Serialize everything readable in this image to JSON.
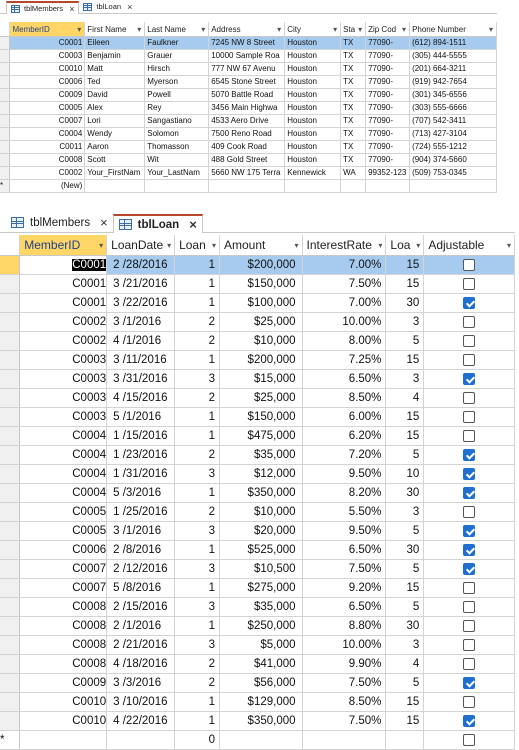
{
  "members": {
    "tabs": [
      {
        "label": "tblMembers",
        "active": true
      },
      {
        "label": "tblLoan",
        "active": false
      }
    ],
    "columns": [
      "MemberID",
      "First Name",
      "Last Name",
      "Address",
      "City",
      "Sta",
      "Zip Cod",
      "Phone Number"
    ],
    "rows": [
      [
        "C0001",
        "Eileen",
        "Faulkner",
        "7245 NW 8 Street",
        "Houston",
        "TX",
        "77090-",
        "(612) 894-1511"
      ],
      [
        "C0003",
        "Benjamin",
        "Grauer",
        "10000 Sample Roa",
        "Houston",
        "TX",
        "77090-",
        "(305) 444-5555"
      ],
      [
        "C0010",
        "Matt",
        "Hirsch",
        "777 NW 67 Avenu",
        "Houston",
        "TX",
        "77090-",
        "(201) 664-3211"
      ],
      [
        "C0006",
        "Ted",
        "Myerson",
        "6545 Stone Street",
        "Houston",
        "TX",
        "77090-",
        "(919) 942-7654"
      ],
      [
        "C0009",
        "David",
        "Powell",
        "5070 Battle Road",
        "Houston",
        "TX",
        "77090-",
        "(301) 345-6556"
      ],
      [
        "C0005",
        "Alex",
        "Rey",
        "3456 Main Highwa",
        "Houston",
        "TX",
        "77090-",
        "(303) 555-6666"
      ],
      [
        "C0007",
        "Lori",
        "Sangastiano",
        "4533 Aero Drive",
        "Houston",
        "TX",
        "77090-",
        "(707) 542-3411"
      ],
      [
        "C0004",
        "Wendy",
        "Solomon",
        "7500 Reno Road",
        "Houston",
        "TX",
        "77090-",
        "(713) 427-3104"
      ],
      [
        "C0011",
        "Aaron",
        "Thomasson",
        "409 Cook Road",
        "Houston",
        "TX",
        "77090-",
        "(724) 555-1212"
      ],
      [
        "C0008",
        "Scott",
        "Wit",
        "488 Gold Street",
        "Houston",
        "TX",
        "77090-",
        "(904) 374-5660"
      ],
      [
        "C0002",
        "Your_FirstNam",
        "Your_LastNam",
        "5660 NW 175 Terra",
        "Kennewick",
        "WA",
        "99352-123",
        "(509) 753-0345"
      ]
    ],
    "new_row": {
      "marker": "*",
      "id_text": "(New)"
    }
  },
  "loan": {
    "tabs": [
      {
        "label": "tblMembers",
        "active": false
      },
      {
        "label": "tblLoan",
        "active": true
      }
    ],
    "columns": [
      "MemberID",
      "LoanDate",
      "Loan",
      "Amount",
      "InterestRate",
      "Loa",
      "Adjustable"
    ],
    "rows": [
      [
        "C0001",
        "2 /28/2016",
        "1",
        "$200,000",
        "7.00%",
        "15",
        false
      ],
      [
        "C0001",
        "3 /21/2016",
        "1",
        "$150,000",
        "7.50%",
        "15",
        false
      ],
      [
        "C0001",
        "3 /22/2016",
        "1",
        "$100,000",
        "7.00%",
        "30",
        true
      ],
      [
        "C0002",
        "3 /1/2016",
        "2",
        "$25,000",
        "10.00%",
        "3",
        false
      ],
      [
        "C0002",
        "4 /1/2016",
        "2",
        "$10,000",
        "8.00%",
        "5",
        false
      ],
      [
        "C0003",
        "3 /11/2016",
        "1",
        "$200,000",
        "7.25%",
        "15",
        false
      ],
      [
        "C0003",
        "3 /31/2016",
        "3",
        "$15,000",
        "6.50%",
        "3",
        true
      ],
      [
        "C0003",
        "4 /15/2016",
        "2",
        "$25,000",
        "8.50%",
        "4",
        false
      ],
      [
        "C0003",
        "5 /1/2016",
        "1",
        "$150,000",
        "6.00%",
        "15",
        false
      ],
      [
        "C0004",
        "1 /15/2016",
        "1",
        "$475,000",
        "6.20%",
        "15",
        false
      ],
      [
        "C0004",
        "1 /23/2016",
        "2",
        "$35,000",
        "7.20%",
        "5",
        true
      ],
      [
        "C0004",
        "1 /31/2016",
        "3",
        "$12,000",
        "9.50%",
        "10",
        true
      ],
      [
        "C0004",
        "5 /3/2016",
        "1",
        "$350,000",
        "8.20%",
        "30",
        true
      ],
      [
        "C0005",
        "1 /25/2016",
        "2",
        "$10,000",
        "5.50%",
        "3",
        false
      ],
      [
        "C0005",
        "3 /1/2016",
        "3",
        "$20,000",
        "9.50%",
        "5",
        true
      ],
      [
        "C0006",
        "2 /8/2016",
        "1",
        "$525,000",
        "6.50%",
        "30",
        true
      ],
      [
        "C0007",
        "2 /12/2016",
        "3",
        "$10,500",
        "7.50%",
        "5",
        true
      ],
      [
        "C0007",
        "5 /8/2016",
        "1",
        "$275,000",
        "9.20%",
        "15",
        false
      ],
      [
        "C0008",
        "2 /15/2016",
        "3",
        "$35,000",
        "6.50%",
        "5",
        false
      ],
      [
        "C0008",
        "2 /1/2016",
        "1",
        "$250,000",
        "8.80%",
        "30",
        false
      ],
      [
        "C0008",
        "2 /21/2016",
        "3",
        "$5,000",
        "10.00%",
        "3",
        false
      ],
      [
        "C0008",
        "4 /18/2016",
        "2",
        "$41,000",
        "9.90%",
        "4",
        false
      ],
      [
        "C0009",
        "3 /3/2016",
        "2",
        "$56,000",
        "7.50%",
        "5",
        true
      ],
      [
        "C0010",
        "3 /10/2016",
        "1",
        "$129,000",
        "8.50%",
        "15",
        false
      ],
      [
        "C0010",
        "4 /22/2016",
        "1",
        "$350,000",
        "7.50%",
        "15",
        true
      ]
    ],
    "new_row": {
      "marker": "*",
      "loan_default": "0",
      "adjustable": false
    }
  },
  "icons": {
    "close": "×",
    "dropdown": "▾"
  },
  "colors": {
    "selected_row": "#a6cbef",
    "header_highlight": "#ffd666",
    "tab_accent": "#b7472a",
    "checkbox_on": "#1f6fd1"
  }
}
